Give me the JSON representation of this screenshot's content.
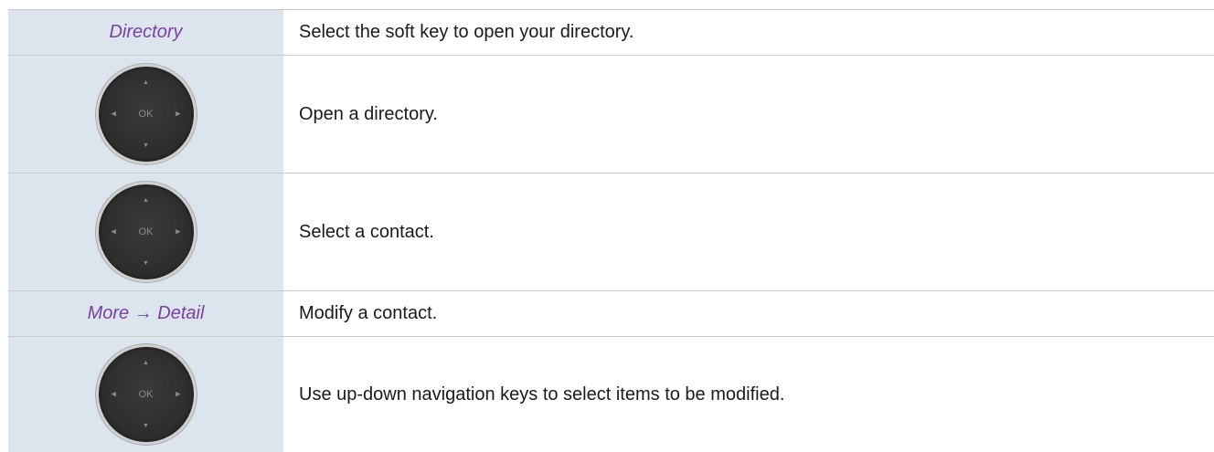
{
  "rows": [
    {
      "left": "Directory",
      "right": "Select the soft key to open your directory."
    },
    {
      "left_icon": "navigation-pad-icon",
      "ok_label": "OK",
      "right": "Open a directory."
    },
    {
      "left_icon": "navigation-pad-icon",
      "ok_label": "OK",
      "right": "Select a contact."
    },
    {
      "left": "More → Detail",
      "right": "Modify a contact."
    },
    {
      "left_icon": "navigation-pad-icon",
      "ok_label": "OK",
      "right": "Use up-down navigation keys to select items to be modified."
    }
  ],
  "colors": {
    "left_cell_bg": "#dce5ee",
    "softkey_text": "#7b3fa0",
    "navpad_body": "#2c2c2c",
    "navpad_ring": "#cfcfcf"
  }
}
